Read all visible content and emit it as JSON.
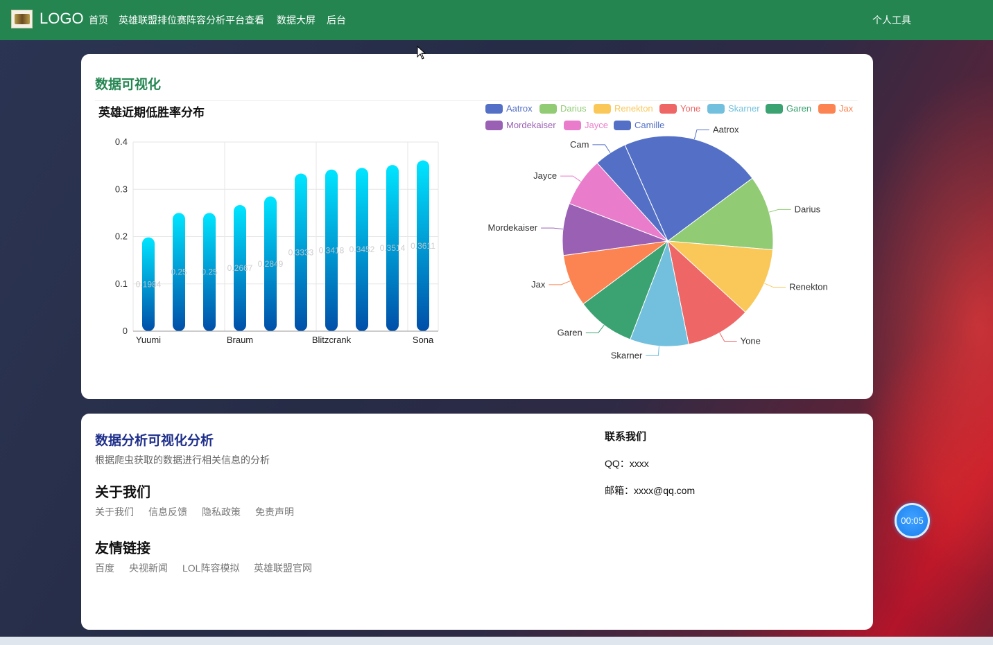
{
  "nav": {
    "logo_text": "LOGO",
    "items": [
      "首页",
      "英雄联盟排位赛阵容分析平台查看",
      "数据大屏",
      "后台"
    ],
    "right_item": "个人工具"
  },
  "viz": {
    "section_title": "数据可视化"
  },
  "chart_data": [
    {
      "type": "bar",
      "title": "英雄近期低胜率分布",
      "categories": [
        "Yuumi",
        "",
        "",
        "Braum",
        "",
        "",
        "Blitzcrank",
        "",
        "",
        "Sona"
      ],
      "tick_labels": [
        "Yuumi",
        "Braum",
        "Blitzcrank",
        "Sona"
      ],
      "values": [
        0.1984,
        0.25,
        0.25,
        0.2667,
        0.2849,
        0.3333,
        0.3418,
        0.3452,
        0.3514,
        0.3611
      ],
      "value_labels": [
        "0.1984",
        "0.25",
        "0.25",
        "0.2667",
        "0.2849",
        "0.3333",
        "0.3418",
        "0.3452",
        "0.3514",
        "0.3611"
      ],
      "ylim": [
        0,
        0.4
      ],
      "yticks": [
        "0",
        "0.1",
        "0.2",
        "0.3",
        "0.4"
      ],
      "grid": true,
      "colors": {
        "bar_top": "#00e5ff",
        "bar_bottom": "#004fa8"
      }
    },
    {
      "type": "pie",
      "legend_position": "top",
      "slices": [
        {
          "name": "Aatrox",
          "value": 21.5,
          "color": "#5470c6"
        },
        {
          "name": "Darius",
          "value": 11.5,
          "color": "#91cc75"
        },
        {
          "name": "Renekton",
          "value": 10.5,
          "color": "#fac858"
        },
        {
          "name": "Yone",
          "value": 10.0,
          "color": "#ee6666"
        },
        {
          "name": "Skarner",
          "value": 9.0,
          "color": "#73c0de"
        },
        {
          "name": "Garen",
          "value": 9.0,
          "color": "#3ba272"
        },
        {
          "name": "Jax",
          "value": 8.0,
          "color": "#fc8452"
        },
        {
          "name": "Mordekaiser",
          "value": 8.0,
          "color": "#9a60b4"
        },
        {
          "name": "Jayce",
          "value": 7.5,
          "color": "#ea7ccc"
        },
        {
          "name": "Camille",
          "value": 5.0,
          "color": "#5470c6"
        }
      ],
      "outside_labels": [
        "Aatrox",
        "Darius",
        "Renekton",
        "Yone",
        "Skarner",
        "Garen",
        "Jax",
        "Mordekaiser",
        "Jayce",
        "Cam"
      ]
    }
  ],
  "footer": {
    "title": "数据分析可视化分析",
    "subtitle": "根据爬虫获取的数据进行相关信息的分析",
    "about_heading": "关于我们",
    "about_links": [
      "关于我们",
      "信息反馈",
      "隐私政策",
      "免责声明"
    ],
    "friends_heading": "友情链接",
    "friend_links": [
      "百度",
      "央视新闻",
      "LOL阵容模拟",
      "英雄联盟官网"
    ],
    "contact_heading": "联系我们",
    "contact_qq": "QQ：xxxx",
    "contact_email": "邮箱：xxxx@qq.com"
  },
  "timer": {
    "label": "00:05"
  }
}
